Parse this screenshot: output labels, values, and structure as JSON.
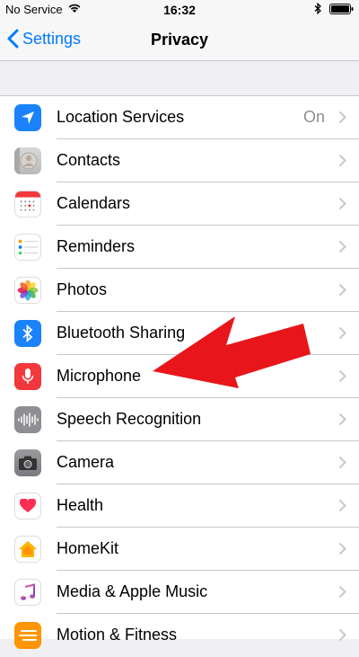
{
  "status_bar": {
    "carrier": "No Service",
    "time": "16:32"
  },
  "nav": {
    "back_label": "Settings",
    "title": "Privacy"
  },
  "rows": [
    {
      "label": "Location Services",
      "value": "On",
      "icon": "location-arrow-icon",
      "color": "#1a82fb"
    },
    {
      "label": "Contacts",
      "value": "",
      "icon": "contacts-icon",
      "color": "#cdcdcd"
    },
    {
      "label": "Calendars",
      "value": "",
      "icon": "calendar-icon",
      "color": "#ffffff"
    },
    {
      "label": "Reminders",
      "value": "",
      "icon": "reminders-icon",
      "color": "#ffffff"
    },
    {
      "label": "Photos",
      "value": "",
      "icon": "photos-icon",
      "color": "#ffffff"
    },
    {
      "label": "Bluetooth Sharing",
      "value": "",
      "icon": "bluetooth-icon",
      "color": "#1a82fb"
    },
    {
      "label": "Microphone",
      "value": "",
      "icon": "microphone-icon",
      "color": "#f2383c"
    },
    {
      "label": "Speech Recognition",
      "value": "",
      "icon": "speech-waveform-icon",
      "color": "#8e8e93"
    },
    {
      "label": "Camera",
      "value": "",
      "icon": "camera-icon",
      "color": "#8e8e93"
    },
    {
      "label": "Health",
      "value": "",
      "icon": "health-heart-icon",
      "color": "#ffffff"
    },
    {
      "label": "HomeKit",
      "value": "",
      "icon": "homekit-house-icon",
      "color": "#ffffff"
    },
    {
      "label": "Media & Apple Music",
      "value": "",
      "icon": "music-note-icon",
      "color": "#ffffff"
    },
    {
      "label": "Motion & Fitness",
      "value": "",
      "icon": "motion-fitness-icon",
      "color": "#ff9500"
    }
  ],
  "colors": {
    "accent": "#007aff",
    "annotation_arrow": "#e8161b"
  }
}
